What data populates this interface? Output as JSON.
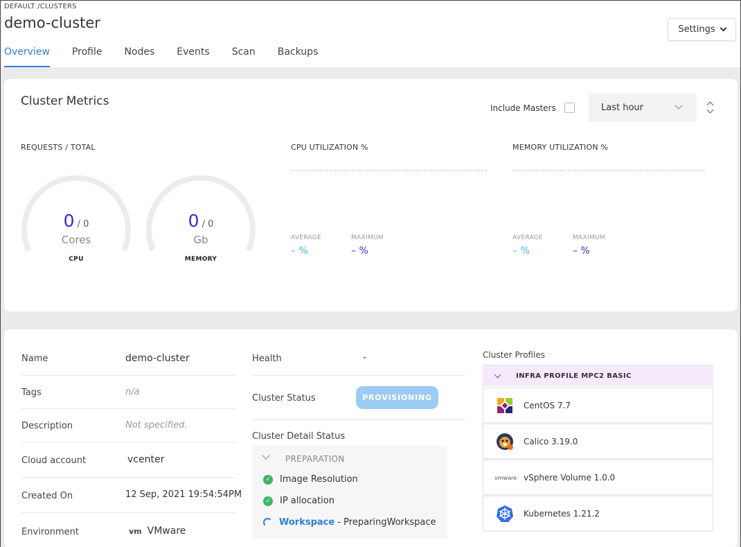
{
  "breadcrumb": "DEFAULT /CLUSTERS",
  "title": "demo-cluster",
  "settings_label": "Settings",
  "tabs": [
    {
      "label": "Overview",
      "active": true
    },
    {
      "label": "Profile"
    },
    {
      "label": "Nodes"
    },
    {
      "label": "Events"
    },
    {
      "label": "Scan"
    },
    {
      "label": "Backups"
    }
  ],
  "metrics": {
    "title": "Cluster Metrics",
    "include_masters_label": "Include Masters",
    "include_masters_checked": false,
    "timeframe": "Last hour",
    "requests_label": "REQUESTS / TOTAL",
    "cpu_gauge": {
      "value": "0",
      "total": "/ 0",
      "unit": "Cores",
      "caption": "CPU"
    },
    "memory_gauge": {
      "value": "0",
      "total": "/ 0",
      "unit": "Gb",
      "caption": "MEMORY"
    },
    "cpu_util": {
      "label": "CPU UTILIZATION %",
      "avg_label": "AVERAGE",
      "avg_value": "– %",
      "max_label": "MAXIMUM",
      "max_value": "– %"
    },
    "mem_util": {
      "label": "MEMORY UTILIZATION %",
      "avg_label": "AVERAGE",
      "avg_value": "– %",
      "max_label": "MAXIMUM",
      "max_value": "– %"
    }
  },
  "details": {
    "name_label": "Name",
    "name_value": "demo-cluster",
    "tags_label": "Tags",
    "tags_value": "n/a",
    "description_label": "Description",
    "description_value": "Not specified.",
    "cloud_label": "Cloud account",
    "cloud_value": "vcenter",
    "created_label": "Created On",
    "created_value": "12 Sep, 2021 19:54:54PM",
    "env_label": "Environment",
    "env_icon_text": "vm",
    "env_value": "VMware",
    "health_label": "Health",
    "health_value": "-",
    "status_label": "Cluster Status",
    "status_value": "PROVISIONING",
    "detail_status_label": "Cluster Detail Status",
    "stage": "PREPARATION",
    "steps": [
      {
        "label": "Image Resolution",
        "state": "done"
      },
      {
        "label": "IP allocation",
        "state": "done"
      },
      {
        "label": "Workspace",
        "suffix": " - PreparingWorkspace",
        "state": "in-progress"
      }
    ]
  },
  "profiles": {
    "title": "Cluster Profiles",
    "profile_name": "INFRA PROFILE MPC2 BASIC",
    "layers": [
      {
        "label": "CentOS 7.7",
        "icon": "centos-icon"
      },
      {
        "label": "Calico 3.19.0",
        "icon": "calico-icon"
      },
      {
        "label": "vSphere Volume 1.0.0",
        "icon": "vmware-icon",
        "icon_text": "vmware"
      },
      {
        "label": "Kubernetes 1.21.2",
        "icon": "kubernetes-icon"
      }
    ]
  },
  "colors": {
    "accent": "#2f7fd8",
    "gauge_value": "#3a2ad8",
    "avg": "#3cb8e6",
    "success": "#3db568",
    "provisioning": "#9ccbf3"
  }
}
